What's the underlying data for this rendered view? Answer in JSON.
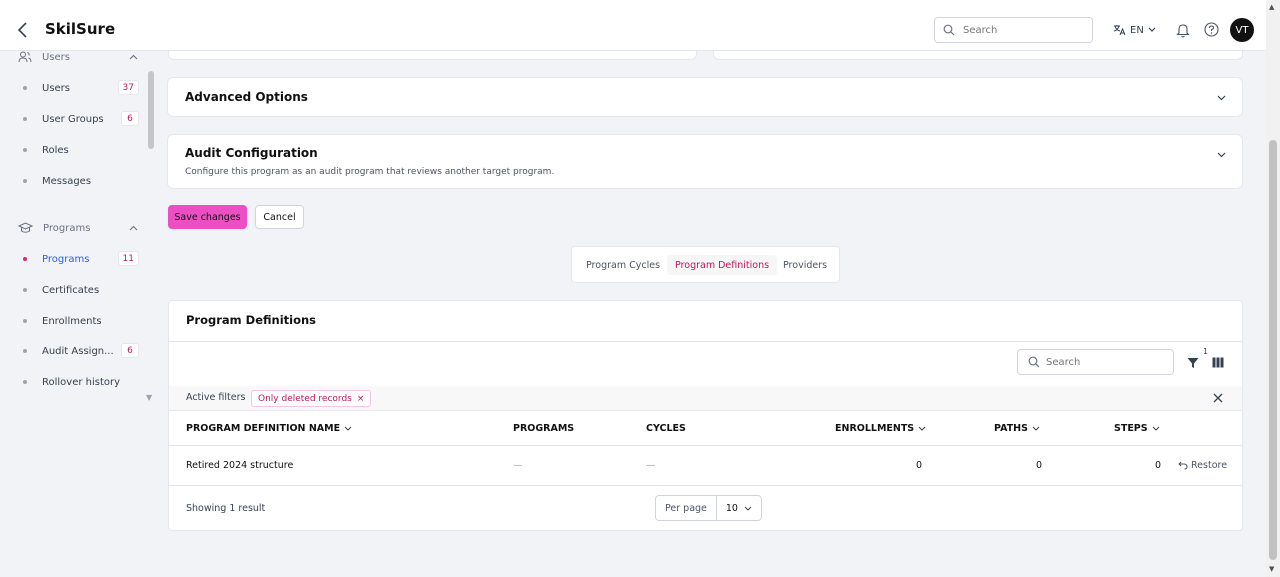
{
  "app": {
    "title": "SkilSure"
  },
  "header": {
    "search_placeholder": "Search",
    "language": "EN",
    "avatar_initials": "VT"
  },
  "sidebar": {
    "groups": [
      {
        "label": "Users",
        "items": [
          {
            "label": "Users",
            "badge": "37"
          },
          {
            "label": "User Groups",
            "badge": "6"
          },
          {
            "label": "Roles",
            "badge": ""
          },
          {
            "label": "Messages",
            "badge": ""
          }
        ]
      },
      {
        "label": "Programs",
        "items": [
          {
            "label": "Programs",
            "badge": "11",
            "active": true
          },
          {
            "label": "Certificates",
            "badge": ""
          },
          {
            "label": "Enrollments",
            "badge": ""
          },
          {
            "label": "Audit Assign...",
            "badge": "6"
          },
          {
            "label": "Rollover history",
            "badge": ""
          }
        ]
      }
    ]
  },
  "sections": {
    "advanced": {
      "title": "Advanced Options"
    },
    "audit": {
      "title": "Audit Configuration",
      "subtitle": "Configure this program as an audit program that reviews another target program."
    }
  },
  "actions": {
    "save_label": "Save changes",
    "cancel_label": "Cancel"
  },
  "tabs": [
    {
      "label": "Program Cycles",
      "active": false
    },
    {
      "label": "Program Definitions",
      "active": true
    },
    {
      "label": "Providers",
      "active": false
    }
  ],
  "table": {
    "title": "Program Definitions",
    "search_placeholder": "Search",
    "filter_count": "1",
    "active_filters_label": "Active filters",
    "filter_chip": "Only deleted records",
    "columns": {
      "name": "PROGRAM DEFINITION NAME",
      "programs": "PROGRAMS",
      "cycles": "CYCLES",
      "enrollments": "ENROLLMENTS",
      "paths": "PATHS",
      "steps": "STEPS"
    },
    "rows": [
      {
        "name": "Retired 2024 structure",
        "programs": "—",
        "cycles": "—",
        "enrollments": "0",
        "paths": "0",
        "steps": "0",
        "action": "Restore"
      }
    ],
    "showing": "Showing 1 result",
    "per_page_label": "Per page",
    "per_page_value": "10"
  },
  "colors": {
    "accent": "#ec4fc4",
    "accent_text": "#be185d",
    "link_active": "#2563eb"
  }
}
